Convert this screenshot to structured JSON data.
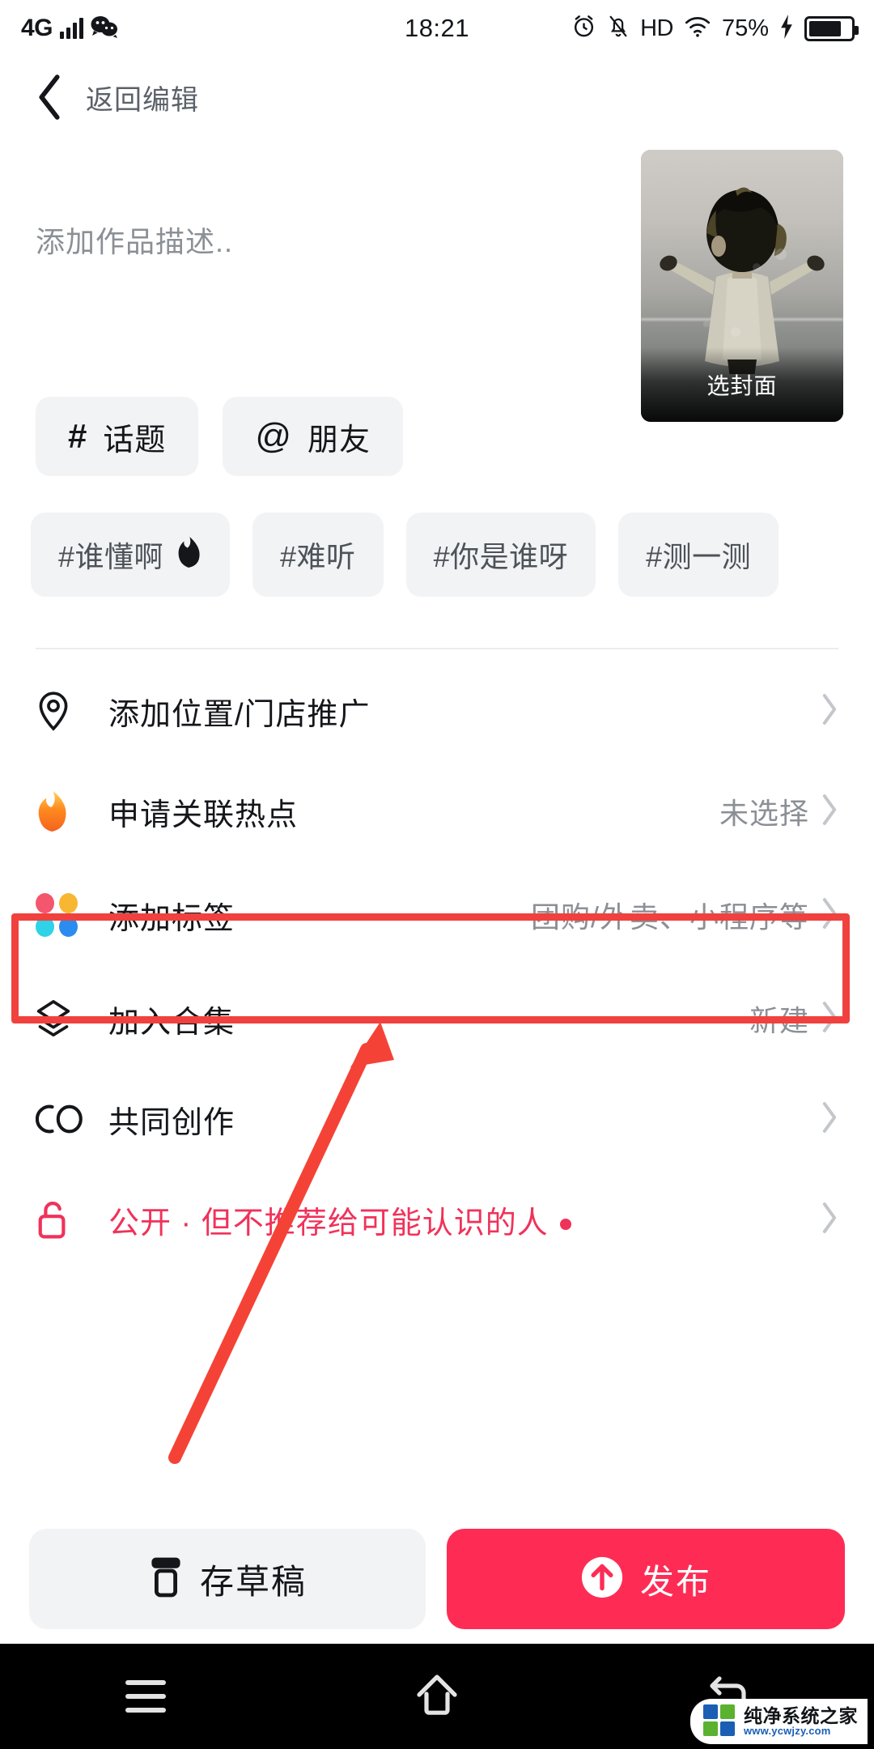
{
  "status_bar": {
    "network": "4G",
    "signal_icon": "signal-bars-icon",
    "app_icon": "wechat-icon",
    "time": "18:21",
    "alarm_icon": "alarm-icon",
    "mute_icon": "bell-muted-icon",
    "hd": "HD",
    "wifi_icon": "wifi-icon",
    "battery_percent": "75%",
    "charging_icon": "lightning-icon",
    "battery_icon": "battery-icon"
  },
  "header": {
    "back_icon": "back-chevron-icon",
    "title": "返回编辑"
  },
  "description": {
    "placeholder": "添加作品描述..",
    "value": ""
  },
  "cover": {
    "label": "选封面",
    "image_alt": "child-with-open-arms-photo"
  },
  "chips": [
    {
      "symbol": "#",
      "label": "话题",
      "name": "topic-chip"
    },
    {
      "symbol": "@",
      "label": "朋友",
      "name": "friend-chip"
    }
  ],
  "hashtag_suggestions": [
    {
      "label": "#谁懂啊",
      "emoji": "🔥"
    },
    {
      "label": "#难听",
      "emoji": ""
    },
    {
      "label": "#你是谁呀",
      "emoji": ""
    },
    {
      "label": "#测一测",
      "emoji": ""
    }
  ],
  "menu": [
    {
      "icon": "location-pin-icon",
      "label": "添加位置/门店推广",
      "value": "",
      "chevron": "chevron-right-icon",
      "highlighted": false
    },
    {
      "icon": "flame-icon",
      "label": "申请关联热点",
      "value": "未选择",
      "chevron": "chevron-right-icon",
      "highlighted": false
    },
    {
      "icon": "four-color-dots-icon",
      "label": "添加标签",
      "value": "团购/外卖、小程序等",
      "chevron": "chevron-right-icon",
      "highlighted": true
    },
    {
      "icon": "layers-icon",
      "label": "加入合集",
      "value": "新建",
      "chevron": "chevron-right-icon",
      "highlighted": false
    },
    {
      "icon": "co-create-icon",
      "label": "共同创作",
      "value": "",
      "chevron": "chevron-right-icon",
      "highlighted": false
    },
    {
      "icon": "unlock-icon",
      "label": "公开 · 但不推荐给可能认识的人",
      "value": "",
      "chevron": "chevron-right-icon",
      "highlighted": false,
      "privacy": true
    }
  ],
  "actions": {
    "draft_label": "存草稿",
    "draft_icon": "draft-box-icon",
    "publish_label": "发布",
    "publish_icon": "arrow-up-circle-icon"
  },
  "navbar": {
    "menu_icon": "nav-menu-icon",
    "home_icon": "nav-home-icon",
    "back_icon": "nav-back-icon"
  },
  "watermark": {
    "title": "纯净系统之家",
    "url": "www.ycwjzy.com"
  },
  "colors": {
    "accent_red": "#fe2c55",
    "highlight_border": "#f0413f",
    "annotation_arrow": "#f44336",
    "privacy_text": "#f0325a",
    "chip_bg": "#f2f3f5",
    "muted_text": "#8b9096"
  }
}
